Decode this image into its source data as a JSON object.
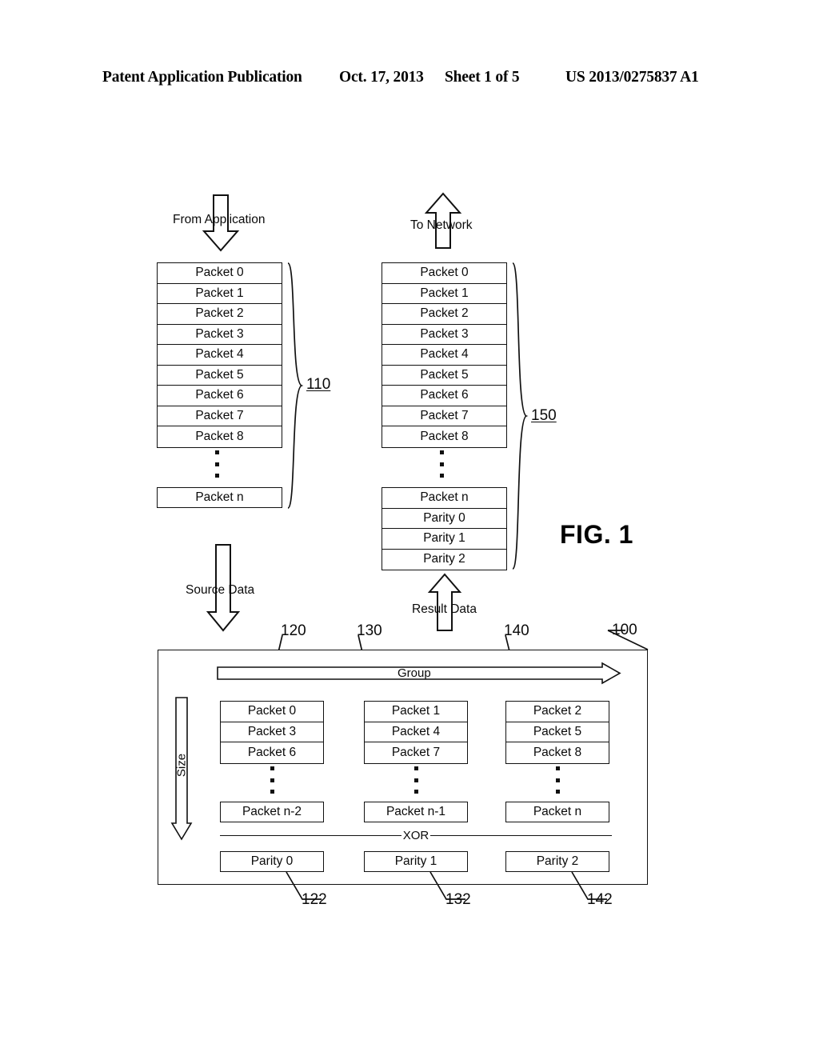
{
  "header": {
    "publication": "Patent Application Publication",
    "date": "Oct. 17, 2013",
    "sheet": "Sheet 1 of 5",
    "patent_number": "US 2013/0275837 A1"
  },
  "figure": {
    "caption": "FIG. 1",
    "reference_numerals": {
      "source_queue": "110",
      "result_queue": "150",
      "system": "100",
      "column_1": "120",
      "column_2": "130",
      "column_3": "140",
      "parity_1": "122",
      "parity_2": "132",
      "parity_3": "142"
    },
    "flow_labels": {
      "from_application": "From Application",
      "to_network": "To Network",
      "source_data": "Source Data",
      "result_data": "Result Data",
      "group": "Group",
      "size": "Size",
      "xor": "XOR"
    },
    "source_queue": {
      "rows": [
        "Packet 0",
        "Packet 1",
        "Packet 2",
        "Packet 3",
        "Packet 4",
        "Packet 5",
        "Packet 6",
        "Packet 7",
        "Packet 8"
      ],
      "tail_row": "Packet n"
    },
    "result_queue": {
      "rows": [
        "Packet 0",
        "Packet 1",
        "Packet 2",
        "Packet 3",
        "Packet 4",
        "Packet 5",
        "Packet 6",
        "Packet 7",
        "Packet 8"
      ],
      "tail_rows": [
        "Packet n",
        "Parity 0",
        "Parity 1",
        "Parity 2"
      ]
    },
    "columns": [
      {
        "ref": "120",
        "packets": [
          "Packet 0",
          "Packet 3",
          "Packet 6"
        ],
        "tail_packet": "Packet n-2",
        "parity": "Parity 0",
        "parity_ref": "122"
      },
      {
        "ref": "130",
        "packets": [
          "Packet 1",
          "Packet 4",
          "Packet 7"
        ],
        "tail_packet": "Packet n-1",
        "parity": "Parity 1",
        "parity_ref": "132"
      },
      {
        "ref": "140",
        "packets": [
          "Packet 2",
          "Packet 5",
          "Packet 8"
        ],
        "tail_packet": "Packet n",
        "parity": "Parity 2",
        "parity_ref": "142"
      }
    ]
  }
}
